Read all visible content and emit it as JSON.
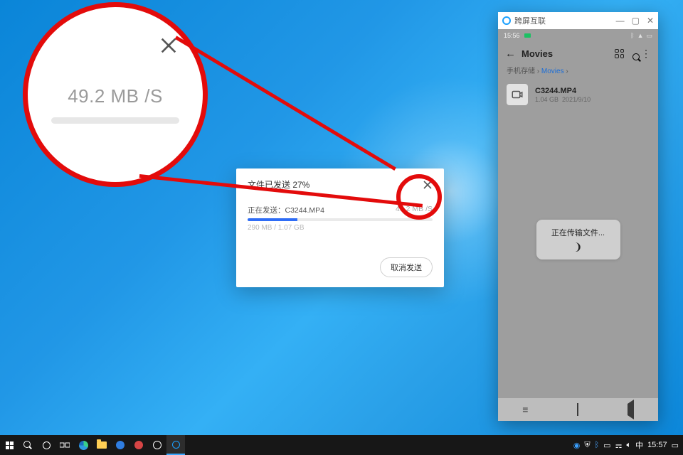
{
  "desktop": {},
  "dialog": {
    "title": "文件已发送 27%",
    "sending_prefix": "正在发送：",
    "file": "C3244.MP4",
    "speed": "49.2 MB /S",
    "sent_size": "290 MB / 1.07 GB",
    "cancel": "取消发送",
    "progress_pct": 27
  },
  "magnifier": {
    "speed": "49.2 MB /S"
  },
  "phone_window": {
    "app_title": "跨屏互联",
    "status_time": "15:56",
    "nav_title": "Movies",
    "breadcrumb_root": "手机存储",
    "breadcrumb_sep": "›",
    "breadcrumb_leaf": "Movies",
    "file": {
      "name": "C3244.MP4",
      "size": "1.04 GB",
      "date": "2021/9/10"
    },
    "toast": "正在传输文件..."
  },
  "taskbar": {
    "tray_wifi": "📶",
    "tray_vol": "🔈",
    "ime": "中",
    "clock": "15:57"
  }
}
